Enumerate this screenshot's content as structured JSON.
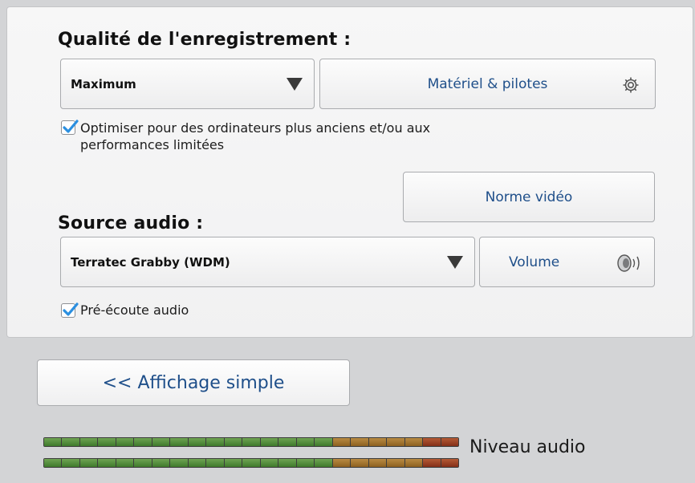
{
  "recording": {
    "heading": "Qualité de l'enregistrement :",
    "quality_value": "Maximum",
    "hardware_button": "Matériel & pilotes",
    "optimize_checked": true,
    "optimize_label_line1": "Optimiser pour des ordinateurs plus anciens et/ou aux",
    "optimize_label_line2": "performances limitées",
    "video_norm_button": "Norme vidéo"
  },
  "audio": {
    "heading": "Source audio :",
    "source_value": "Terratec Grabby (WDM)",
    "volume_button": "Volume",
    "preview_checked": true,
    "preview_label": "Pré-écoute audio"
  },
  "simple_view_button": "<< Affichage simple",
  "meter": {
    "label": "Niveau audio",
    "segments_green": 16,
    "segments_orange": 5,
    "segments_red": 2,
    "colors": {
      "green": "#4f8a38",
      "orange": "#a3742f",
      "red": "#9b4224"
    }
  },
  "accent_color": "#1f4f8a",
  "check_color": "#2b8fe0"
}
